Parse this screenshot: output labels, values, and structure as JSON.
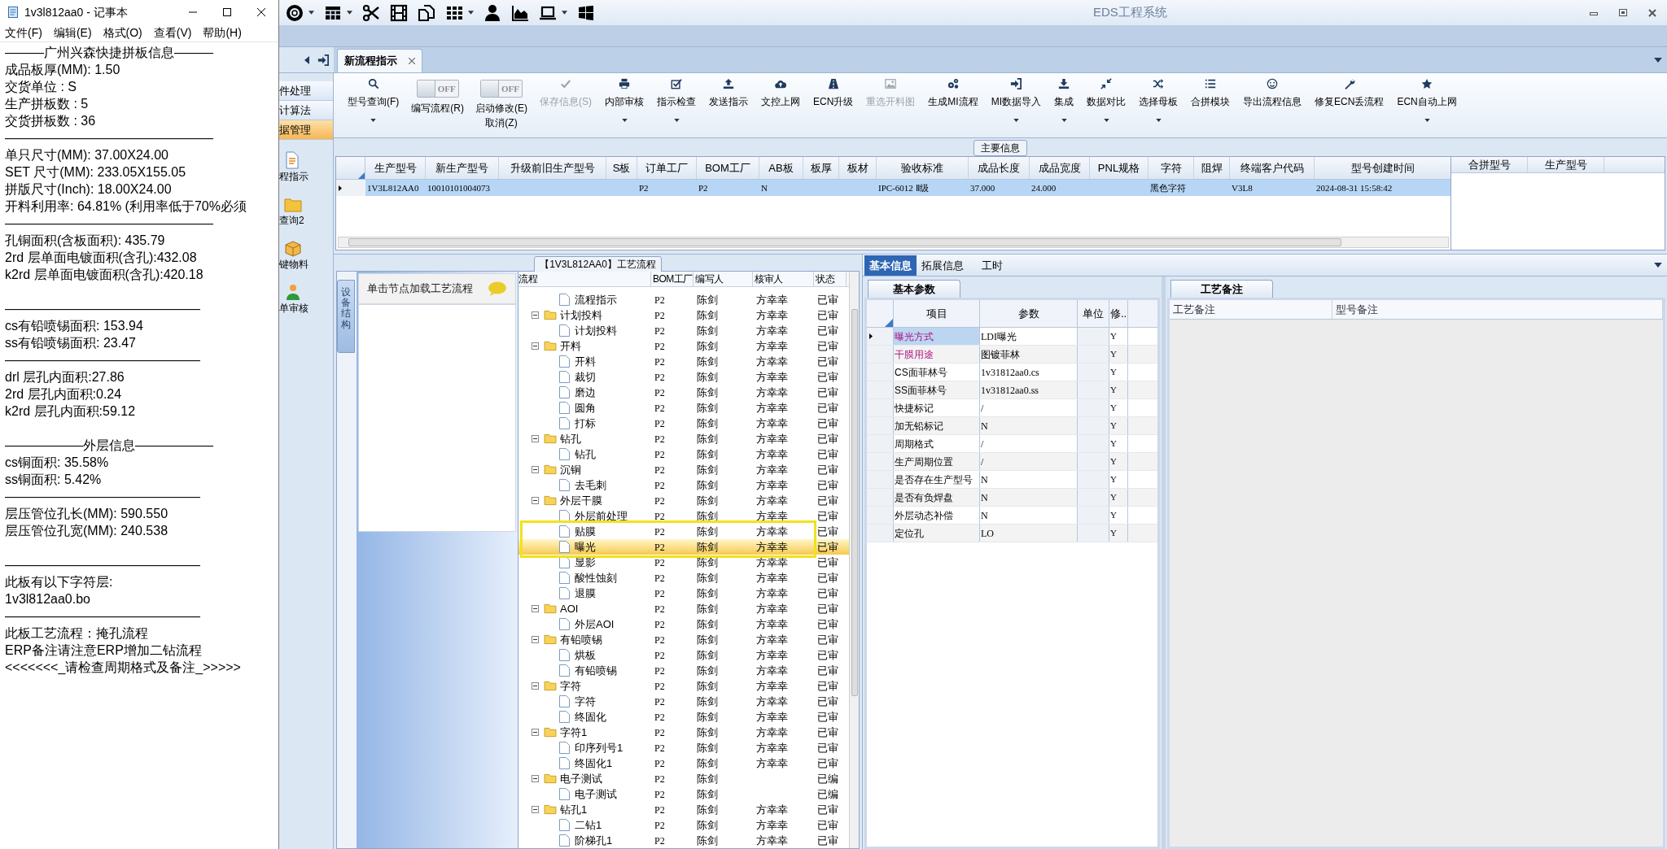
{
  "notepad": {
    "title": "1v3l812aa0 - 记事本",
    "menu": [
      "文件(F)",
      "编辑(E)",
      "格式(O)",
      "查看(V)",
      "帮助(H)"
    ],
    "lines": [
      "———广州兴森快捷拼板信息———",
      "成品板厚(MM): 1.50",
      "交货单位 : S",
      "生产拼板数 : 5",
      "交货拼板数 : 36",
      "————————————————",
      "单只尺寸(MM): 37.00X24.00",
      "SET 尺寸(MM): 233.05X155.05",
      "拼版尺寸(Inch): 18.00X24.00",
      "开料利用率: 64.81% (利用率低于70%必须",
      "————————————————",
      "孔铜面积(含板面积): 435.79",
      "2rd           层单面电镀面积(含孔):432.08",
      "k2rd          层单面电镀面积(含孔):420.18",
      {
        "text": "———————————————",
        "space_before": true
      },
      "cs有铅喷锡面积: 153.94",
      "ss有铅喷锡面积: 23.47",
      "———————————————",
      "drl           层孔内面积:27.86",
      "2rd            层孔内面积:0.24",
      "k2rd           层孔内面积:59.12",
      {
        "text": "——————外层信息——————",
        "space_before": true
      },
      "cs铜面积: 35.58%",
      "ss铜面积: 5.42%",
      "———————————————",
      "层压管位孔长(MM): 590.550",
      "层压管位孔宽(MM): 240.538",
      {
        "text": "———————————————",
        "space_before": true
      },
      "此板有以下字符层:",
      "1v3l812aa0.bo",
      "———————————————",
      "此板工艺流程：掩孔流程",
      "ERP备注请注意ERP增加二钻流程",
      "<<<<<<<_请检查周期格式及备注_>>>>>"
    ]
  },
  "app": {
    "title": "EDS工程系统",
    "nav": {
      "items": [
        {
          "label": "件处理",
          "selected": false
        },
        {
          "label": "计算法",
          "selected": false
        },
        {
          "label": "据管理",
          "selected": true
        }
      ],
      "modules": [
        {
          "label": "程指示"
        },
        {
          "label": "查询2"
        },
        {
          "label": "键物料"
        },
        {
          "label": "单审核"
        }
      ]
    },
    "tabs": [
      {
        "label": "新流程指示",
        "selected": true
      }
    ],
    "ribbon": [
      {
        "kind": "button",
        "label": "型号查询(F)",
        "dropdown": true,
        "disabled": false
      },
      {
        "kind": "toggle",
        "label": "编写流程(R)",
        "on": false,
        "state_text": "OFF"
      },
      {
        "kind": "toggle",
        "label": "启动修改(E)",
        "sublabel": "取消(Z)",
        "on": false,
        "state_text": "OFF"
      },
      {
        "kind": "button",
        "label": "保存信息(S)",
        "dropdown": false,
        "disabled": true
      },
      {
        "kind": "button",
        "label": "内部审核",
        "dropdown": true,
        "disabled": false
      },
      {
        "kind": "button",
        "label": "指示检查",
        "dropdown": true,
        "disabled": false
      },
      {
        "kind": "button",
        "label": "发送指示",
        "dropdown": false,
        "disabled": false
      },
      {
        "kind": "button",
        "label": "文控上网",
        "dropdown": false,
        "disabled": false
      },
      {
        "kind": "button",
        "label": "ECN升级",
        "dropdown": false,
        "disabled": false
      },
      {
        "kind": "button",
        "label": "重选开料图",
        "dropdown": false,
        "disabled": true
      },
      {
        "kind": "button",
        "label": "生成MI流程",
        "dropdown": false,
        "disabled": false
      },
      {
        "kind": "button",
        "label": "MI数据导入",
        "dropdown": true,
        "disabled": false
      },
      {
        "kind": "button",
        "label": "集成",
        "dropdown": true,
        "disabled": false
      },
      {
        "kind": "button",
        "label": "数据对比",
        "dropdown": true,
        "disabled": false
      },
      {
        "kind": "button",
        "label": "选择母板",
        "dropdown": true,
        "disabled": false
      },
      {
        "kind": "button",
        "label": "合拼模块",
        "dropdown": false,
        "disabled": false
      },
      {
        "kind": "button",
        "label": "导出流程信息",
        "dropdown": false,
        "disabled": false
      },
      {
        "kind": "button",
        "label": "修复ECN丢流程",
        "dropdown": false,
        "disabled": false
      },
      {
        "kind": "button",
        "label": "ECN自动上网",
        "dropdown": true,
        "disabled": false
      }
    ],
    "main_info": {
      "title": "主要信息",
      "columns": [
        "生产型号",
        "新生产型号",
        "升级前旧生产型号",
        "S板",
        "订单工厂",
        "BOM工厂",
        "AB板",
        "板厚",
        "板材",
        "验收标准",
        "成品长度",
        "成品宽度",
        "PNL规格",
        "字符",
        "阻焊",
        "终端客户代码",
        "型号创建时间"
      ],
      "rows": [
        {
          "selected": true,
          "cells": [
            "1V3L812AA0",
            "10010101004073",
            null,
            null,
            "P2",
            "P2",
            "N",
            null,
            null,
            "IPC-6012 Ⅱ级",
            "37.000",
            "24.000",
            null,
            "黑色字符",
            null,
            "V3L8",
            "2024-08-31 15:58:42"
          ]
        }
      ],
      "side_columns": [
        "合拼型号",
        "生产型号"
      ]
    },
    "process": {
      "title": "【1V3L812AA0】工艺流程",
      "side_tab": "设备结构",
      "hint": "单击节点加载工艺流程",
      "columns": [
        "流程",
        "BOM工厂",
        "编写人",
        "核审人",
        "状态"
      ],
      "tree": [
        {
          "children": [
            {
              "label": "流程指示",
              "bom": "P2",
              "writer": "陈剑",
              "reviewer": "方幸幸",
              "status": "已审",
              "selected": false
            }
          ]
        },
        {
          "label": "计划投料",
          "bom": "P2",
          "writer": "陈剑",
          "reviewer": "方幸幸",
          "status": "已审",
          "selected": false,
          "expanded": true,
          "children": [
            {
              "label": "计划投料",
              "bom": "P2",
              "writer": "陈剑",
              "reviewer": "方幸幸",
              "status": "已审",
              "selected": false
            }
          ]
        },
        {
          "label": "开料",
          "bom": "P2",
          "writer": "陈剑",
          "reviewer": "方幸幸",
          "status": "已审",
          "selected": false,
          "expanded": true,
          "children": [
            {
              "label": "开料",
              "bom": "P2",
              "writer": "陈剑",
              "reviewer": "方幸幸",
              "status": "已审",
              "selected": false
            },
            {
              "label": "裁切",
              "bom": "P2",
              "writer": "陈剑",
              "reviewer": "方幸幸",
              "status": "已审",
              "selected": false
            },
            {
              "label": "磨边",
              "bom": "P2",
              "writer": "陈剑",
              "reviewer": "方幸幸",
              "status": "已审",
              "selected": false
            },
            {
              "label": "圆角",
              "bom": "P2",
              "writer": "陈剑",
              "reviewer": "方幸幸",
              "status": "已审",
              "selected": false
            },
            {
              "label": "打标",
              "bom": "P2",
              "writer": "陈剑",
              "reviewer": "方幸幸",
              "status": "已审",
              "selected": false
            }
          ]
        },
        {
          "label": "钻孔",
          "bom": "P2",
          "writer": "陈剑",
          "reviewer": "方幸幸",
          "status": "已审",
          "selected": false,
          "expanded": true,
          "children": [
            {
              "label": "钻孔",
              "bom": "P2",
              "writer": "陈剑",
              "reviewer": "方幸幸",
              "status": "已审",
              "selected": false
            }
          ]
        },
        {
          "label": "沉铜",
          "bom": "P2",
          "writer": "陈剑",
          "reviewer": "方幸幸",
          "status": "已审",
          "selected": false,
          "expanded": true,
          "children": [
            {
              "label": "去毛刺",
              "bom": "P2",
              "writer": "陈剑",
              "reviewer": "方幸幸",
              "status": "已审",
              "selected": false
            }
          ]
        },
        {
          "label": "外层干膜",
          "bom": "P2",
          "writer": "陈剑",
          "reviewer": "方幸幸",
          "status": "已审",
          "selected": false,
          "expanded": true,
          "children": [
            {
              "label": "外层前处理",
              "bom": "P2",
              "writer": "陈剑",
              "reviewer": "方幸幸",
              "status": "已审",
              "selected": false
            },
            {
              "label": "贴膜",
              "bom": "P2",
              "writer": "陈剑",
              "reviewer": "方幸幸",
              "status": "已审",
              "selected": false,
              "marked": true
            },
            {
              "label": "曝光",
              "bom": "P2",
              "writer": "陈剑",
              "reviewer": "方幸幸",
              "status": "已审",
              "selected": true,
              "marked": true
            },
            {
              "label": "显影",
              "bom": "P2",
              "writer": "陈剑",
              "reviewer": "方幸幸",
              "status": "已审",
              "selected": false
            },
            {
              "label": "酸性蚀刻",
              "bom": "P2",
              "writer": "陈剑",
              "reviewer": "方幸幸",
              "status": "已审",
              "selected": false
            },
            {
              "label": "退膜",
              "bom": "P2",
              "writer": "陈剑",
              "reviewer": "方幸幸",
              "status": "已审",
              "selected": false
            }
          ]
        },
        {
          "label": "AOI",
          "bom": "P2",
          "writer": "陈剑",
          "reviewer": "方幸幸",
          "status": "已审",
          "selected": false,
          "expanded": true,
          "children": [
            {
              "label": "外层AOI",
              "bom": "P2",
              "writer": "陈剑",
              "reviewer": "方幸幸",
              "status": "已审",
              "selected": false
            }
          ]
        },
        {
          "label": "有铅喷锡",
          "bom": "P2",
          "writer": "陈剑",
          "reviewer": "方幸幸",
          "status": "已审",
          "selected": false,
          "expanded": true,
          "children": [
            {
              "label": "烘板",
              "bom": "P2",
              "writer": "陈剑",
              "reviewer": "方幸幸",
              "status": "已审",
              "selected": false
            },
            {
              "label": "有铅喷锡",
              "bom": "P2",
              "writer": "陈剑",
              "reviewer": "方幸幸",
              "status": "已审",
              "selected": false
            }
          ]
        },
        {
          "label": "字符",
          "bom": "P2",
          "writer": "陈剑",
          "reviewer": "方幸幸",
          "status": "已审",
          "selected": false,
          "expanded": true,
          "children": [
            {
              "label": "字符",
              "bom": "P2",
              "writer": "陈剑",
              "reviewer": "方幸幸",
              "status": "已审",
              "selected": false
            },
            {
              "label": "终固化",
              "bom": "P2",
              "writer": "陈剑",
              "reviewer": "方幸幸",
              "status": "已审",
              "selected": false
            }
          ]
        },
        {
          "label": "字符1",
          "bom": "P2",
          "writer": "陈剑",
          "reviewer": "方幸幸",
          "status": "已审",
          "selected": false,
          "expanded": true,
          "children": [
            {
              "label": "印序列号1",
              "bom": "P2",
              "writer": "陈剑",
              "reviewer": "方幸幸",
              "status": "已审",
              "selected": false
            },
            {
              "label": "终固化1",
              "bom": "P2",
              "writer": "陈剑",
              "reviewer": "方幸幸",
              "status": "已审",
              "selected": false
            }
          ]
        },
        {
          "label": "电子测试",
          "bom": "P2",
          "writer": "陈剑",
          "status": "已编",
          "selected": false,
          "expanded": true,
          "children": [
            {
              "label": "电子测试",
              "bom": "P2",
              "writer": "陈剑",
              "status": "已编",
              "selected": false
            }
          ]
        },
        {
          "label": "钻孔1",
          "bom": "P2",
          "writer": "陈剑",
          "reviewer": "方幸幸",
          "status": "已审",
          "selected": false,
          "expanded": true,
          "children": [
            {
              "label": "二钻1",
              "bom": "P2",
              "writer": "陈剑",
              "reviewer": "方幸幸",
              "status": "已审",
              "selected": false
            },
            {
              "label": "阶梯孔1",
              "bom": "P2",
              "writer": "陈剑",
              "reviewer": "方幸幸",
              "status": "已审",
              "selected": false
            }
          ]
        }
      ]
    },
    "detail": {
      "tabs": [
        {
          "label": "基本信息",
          "selected": true
        },
        {
          "label": "拓展信息",
          "selected": false
        },
        {
          "label": "工时",
          "selected": false
        }
      ],
      "params": {
        "title": "基本参数",
        "columns": [
          "项目",
          "参数",
          "单位",
          "修.."
        ],
        "rows": [
          {
            "name": "曝光方式",
            "value": "LDI曝光",
            "flag": "Y",
            "emphasized": true,
            "selected": true
          },
          {
            "name": "干膜用途",
            "value": "图镀菲林",
            "flag": "Y",
            "emphasized": true,
            "selected": false
          },
          {
            "name": "CS面菲林号",
            "value": "1v31812aa0.cs",
            "flag": "Y",
            "emphasized": false,
            "selected": false
          },
          {
            "name": "SS面菲林号",
            "value": "1v31812aa0.ss",
            "flag": "Y",
            "emphasized": false,
            "selected": false
          },
          {
            "name": "快捷标记",
            "value": "/",
            "flag": "Y",
            "emphasized": false,
            "selected": false
          },
          {
            "name": "加无铅标记",
            "value": "N",
            "flag": "Y",
            "emphasized": false,
            "selected": false
          },
          {
            "name": "周期格式",
            "value": "/",
            "flag": "Y",
            "emphasized": false,
            "selected": false
          },
          {
            "name": "生产周期位置",
            "value": "/",
            "flag": "Y",
            "emphasized": false,
            "selected": false
          },
          {
            "name": "是否存在生产型号",
            "value": "N",
            "flag": "Y",
            "emphasized": false,
            "selected": false
          },
          {
            "name": "是否有负焊盘",
            "value": "N",
            "flag": "Y",
            "emphasized": false,
            "selected": false
          },
          {
            "name": "外层动态补偿",
            "value": "N",
            "flag": "Y",
            "emphasized": false,
            "selected": false
          },
          {
            "name": "定位孔",
            "value": "LO",
            "flag": "Y",
            "emphasized": false,
            "selected": false
          }
        ]
      },
      "notes": {
        "title": "工艺备注",
        "columns": [
          "工艺备注",
          "型号备注"
        ]
      }
    }
  }
}
